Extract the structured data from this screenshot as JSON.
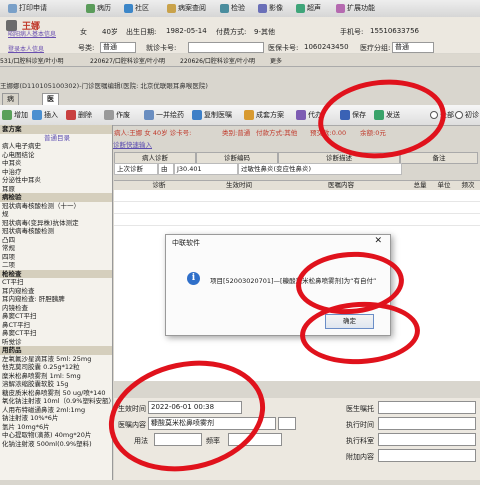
{
  "top_toolbar": [
    {
      "label": "打印申请",
      "icon": "printer-icon"
    },
    {
      "label": "病历",
      "icon": "record-icon"
    },
    {
      "label": "社区",
      "icon": "community-icon"
    },
    {
      "label": "病案查阅",
      "icon": "archive-icon"
    },
    {
      "label": "检验",
      "icon": "lab-icon"
    },
    {
      "label": "影像",
      "icon": "image-icon"
    },
    {
      "label": "超声",
      "icon": "ultrasound-icon"
    },
    {
      "label": "扩展功能",
      "icon": "extend-icon"
    }
  ],
  "patient": {
    "name": "王娜",
    "sub_link": "昭阳病人基本信息",
    "sub_link2": "登录本人信息",
    "sex": "女",
    "age": "40岁",
    "birth_label": "出生日期:",
    "birth": "1982-05-14",
    "fee_label": "付费方式:",
    "fee": "9-其他",
    "phone_label": "手机号:",
    "phone": "15510633756",
    "type_label": "号类:",
    "type": "普通",
    "card_label": "就诊卡号:",
    "card_no": "",
    "med_card_label": "医保卡号:",
    "med_card": "1060243450",
    "bed_label": "医疗分组:",
    "bed": "普通"
  },
  "tabs_row": [
    "531/口腔科诊室/叶小明",
    "220627/口腔科诊室/叶小明",
    "220626/口腔科诊室/叶小明",
    "更多"
  ],
  "path": "王娜娜(D110105100302)-门诊医嘱编辑(医院: 北京优联眼耳鼻喉医院)",
  "page_tabs": [
    "病人信息",
    "医嘱编辑"
  ],
  "toolbar2": [
    {
      "label": "增加",
      "icon": "add-icon"
    },
    {
      "label": "插入",
      "icon": "insert-icon"
    },
    {
      "label": "删除",
      "icon": "delete-icon"
    },
    {
      "label": "作废",
      "icon": "void-icon"
    },
    {
      "label": "一并绘药",
      "icon": "merge-icon"
    },
    {
      "label": "复制医嘱",
      "icon": "copy-icon"
    },
    {
      "label": "成套方案",
      "icon": "package-icon"
    },
    {
      "label": "代办",
      "icon": "proxy-icon"
    },
    {
      "label": "保存",
      "icon": "save-icon"
    },
    {
      "label": "发送",
      "icon": "send-icon"
    },
    {
      "label": "全部",
      "icon": "all-radio"
    },
    {
      "label": "初诊",
      "icon": "first-visit-radio"
    }
  ],
  "left_panel": [
    {
      "t": "套方案",
      "c": "hdr"
    },
    {
      "t": "普通目录",
      "c": "tab"
    },
    {
      "t": "病人电子病史",
      "c": ""
    },
    {
      "t": "心电图结论",
      "c": ""
    },
    {
      "t": "中耳炎",
      "c": ""
    },
    {
      "t": "中治疗",
      "c": ""
    },
    {
      "t": "分泌性中耳炎",
      "c": ""
    },
    {
      "t": "耳原",
      "c": ""
    },
    {
      "t": "病检验",
      "c": "hdr"
    },
    {
      "t": "冠状病毒核酸检测（十一）",
      "c": ""
    },
    {
      "t": "规",
      "c": ""
    },
    {
      "t": "冠状病毒(变异株)抗体测定",
      "c": ""
    },
    {
      "t": "冠状病毒核酸检测",
      "c": ""
    },
    {
      "t": "凸四",
      "c": ""
    },
    {
      "t": "常规",
      "c": ""
    },
    {
      "t": "四项",
      "c": ""
    },
    {
      "t": "二项",
      "c": ""
    },
    {
      "t": "枪检查",
      "c": "hdr"
    },
    {
      "t": "CT平扫",
      "c": ""
    },
    {
      "t": "耳内窥检查",
      "c": ""
    },
    {
      "t": "耳内窥检查: 肝胆胰脾",
      "c": ""
    },
    {
      "t": "内镜检查",
      "c": ""
    },
    {
      "t": "鼻窦CT平扫",
      "c": ""
    },
    {
      "t": "鼻CT平扫",
      "c": ""
    },
    {
      "t": "鼻窦CT平扫",
      "c": ""
    },
    {
      "t": "听觉诊",
      "c": ""
    },
    {
      "t": "用药品",
      "c": "hdr"
    },
    {
      "t": "左氧氟沙星滴耳液 5ml: 25mg",
      "c": ""
    },
    {
      "t": "他克莫司胶囊 0.25g*12粒",
      "c": ""
    },
    {
      "t": "糜米松鼻喷雾剂 1ml: 5mg",
      "c": ""
    },
    {
      "t": "溶解浓缩胶囊软胶 15g",
      "c": ""
    },
    {
      "t": "糖皮质米松鼻喷雾剂 50 ug/喷*140",
      "c": ""
    },
    {
      "t": "氧化钠注射液 10ml（0.9%塑料安瓿）",
      "c": ""
    },
    {
      "t": "人用布特磁通鼻液 2ml:1mg",
      "c": ""
    },
    {
      "t": "钠注射液 10%*6片",
      "c": ""
    },
    {
      "t": "氢片 10mg*6片",
      "c": ""
    },
    {
      "t": "中心提取物(滴蒸) 40mg*20片",
      "c": ""
    },
    {
      "t": "化钠注射液 500ml(0.9%塑料)",
      "c": ""
    }
  ],
  "info_bar": {
    "patient": "病人:王娜 女 40岁 诊卡号:",
    "type": "类别:普通",
    "fee": "付款方式:其他",
    "limit": "预交款:0.00",
    "balance": "余额:0元"
  },
  "link_text": "诊断快速输入",
  "diag_headers": [
    "病人诊断",
    "诊断编码",
    "诊断描述",
    "备注"
  ],
  "diag_row": {
    "label": "上次诊断",
    "flag": "由",
    "code": "J30.401",
    "desc": "过敏性鼻炎(变应性鼻炎)"
  },
  "order_headers": [
    "诊断",
    "生效时间",
    "医嘱内容",
    "总量",
    "单位",
    "频次"
  ],
  "dialog": {
    "title": "中联软件",
    "message": "项目[52003020701]—[糠酸莫米松鼻喷雾剂]为“有自付”",
    "ok": "确定",
    "close": "✕"
  },
  "form": {
    "effective_label": "生效时间",
    "effective": "2022-06-01 00:38",
    "content_label": "医嘱内容",
    "content": "糠酸莫米松鼻喷雾剂",
    "usage_label": "用法",
    "freq_label": "频率",
    "doctor_label": "医生嘱托",
    "exec_time_label": "执行时间",
    "exec_dept_label": "执行科室",
    "extra_label": "附加内容"
  }
}
